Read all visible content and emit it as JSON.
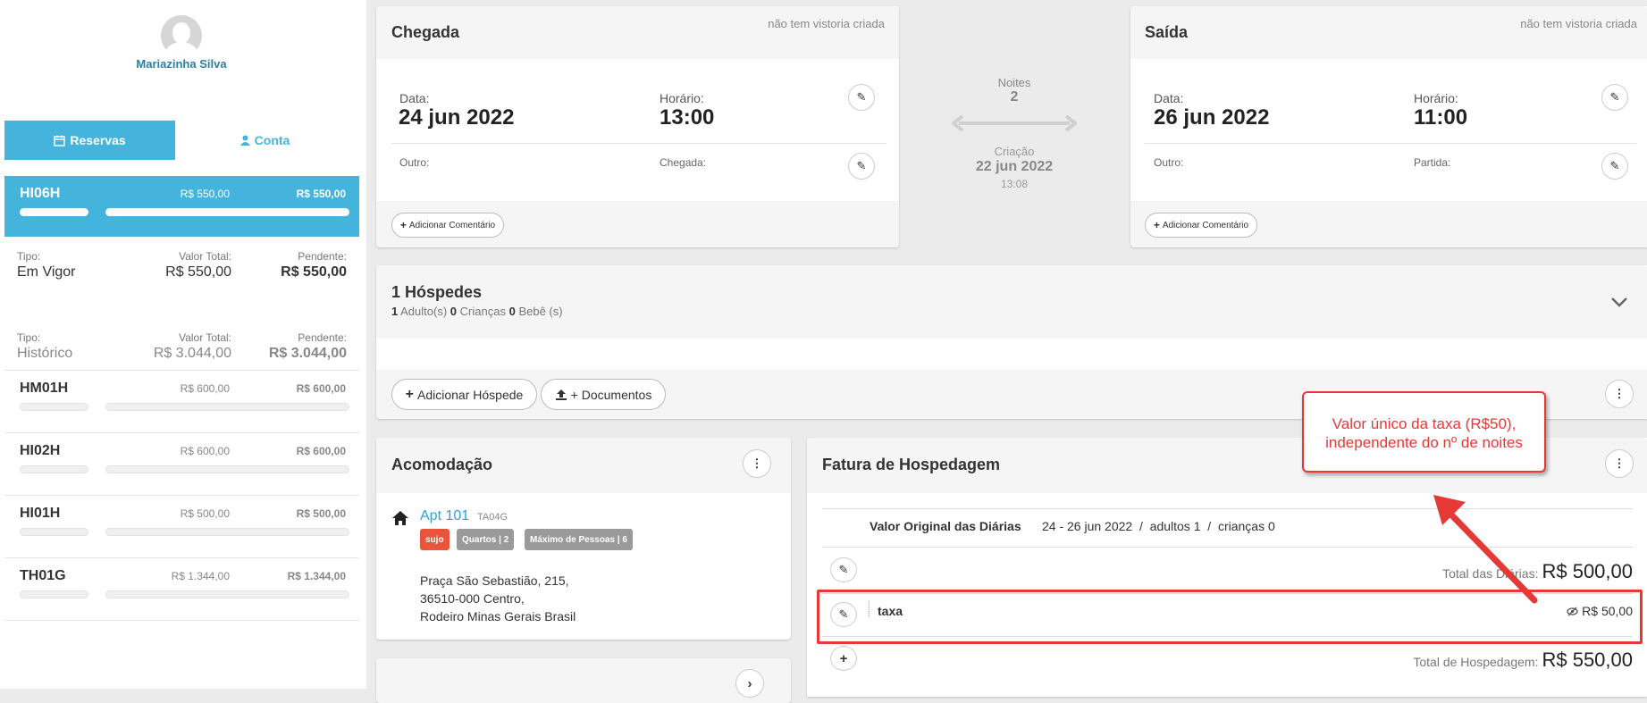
{
  "sidebar": {
    "user_name": "Mariazinha Silva",
    "tabs": [
      {
        "label": "Reservas",
        "icon": "calendar-icon"
      },
      {
        "label": "Conta",
        "icon": "user-icon"
      }
    ],
    "active_reservation": {
      "code": "HI06H",
      "value": "R$ 550,00",
      "pending": "R$ 550,00"
    },
    "summary": [
      {
        "type_label": "Tipo:",
        "type": "Em Vigor",
        "total_label": "Valor Total:",
        "total": "R$ 550,00",
        "pending_label": "Pendente:",
        "pending": "R$ 550,00"
      },
      {
        "type_label": "Tipo:",
        "type": "Histórico",
        "total_label": "Valor Total:",
        "total": "R$ 3.044,00",
        "pending_label": "Pendente:",
        "pending": "R$ 3.044,00"
      }
    ],
    "reservations": [
      {
        "code": "HM01H",
        "value": "R$ 600,00",
        "pending": "R$ 600,00"
      },
      {
        "code": "HI02H",
        "value": "R$ 600,00",
        "pending": "R$ 600,00"
      },
      {
        "code": "HI01H",
        "value": "R$ 500,00",
        "pending": "R$ 500,00"
      },
      {
        "code": "TH01G",
        "value": "R$ 1.344,00",
        "pending": "R$ 1.344,00"
      }
    ]
  },
  "arrival": {
    "title": "Chegada",
    "note": "não tem vistoria criada",
    "date_label": "Data:",
    "date": "24 jun 2022",
    "time_label": "Horário:",
    "time": "13:00",
    "other_label": "Outro:",
    "extra_label": "Chegada:",
    "comment_button": "Adicionar Comentário"
  },
  "middle": {
    "nights_label": "Noites",
    "nights": "2",
    "created_label": "Criação",
    "created_date": "22 jun 2022",
    "created_time": "13:08"
  },
  "departure": {
    "title": "Saída",
    "note": "não tem vistoria criada",
    "date_label": "Data:",
    "date": "26 jun 2022",
    "time_label": "Horário:",
    "time": "11:00",
    "other_label": "Outro:",
    "extra_label": "Partida:",
    "comment_button": "Adicionar Comentário"
  },
  "guests": {
    "title": "1 Hóspedes",
    "adults_count": "1",
    "adults_label": "Adulto(s)",
    "children_count": "0",
    "children_label": "Crianças",
    "babies_count": "0",
    "babies_label": "Bebê (s)",
    "add_guest_button": "Adicionar Hóspede",
    "documents_button": "+ Documentos"
  },
  "accommodation": {
    "title": "Acomodação",
    "room_name": "Apt 101",
    "room_code": "TA04G",
    "badges": [
      {
        "label": "sujo",
        "color": "#e8553a"
      },
      {
        "label": "Quartos | 2",
        "color": "#9a9a9a"
      },
      {
        "label": "Máximo de Pessoas | 6",
        "color": "#9a9a9a"
      }
    ],
    "address_line1": "Praça São Sebastião, 215,",
    "address_line2": "36510-000 Centro,",
    "address_line3": "Rodeiro Minas Gerais Brasil"
  },
  "invoice": {
    "title": "Fatura de Hospedagem",
    "original_label": "Valor Original das Diárias",
    "period": "24 - 26 jun 2022",
    "adults": "adultos 1",
    "children": "crianças 0",
    "total_diarias_label": "Total das Diárias:",
    "total_diarias": "R$ 500,00",
    "fee_name": "taxa",
    "fee_value": "R$ 50,00",
    "total_label": "Total de Hospedagem:",
    "total": "R$ 550,00"
  },
  "annotation": {
    "text_line1": "Valor único da taxa (R$50),",
    "text_line2": "independente do nº de noites",
    "color": "#e53935"
  },
  "colors": {
    "accent": "#45b4dc",
    "link": "#2a7fa6",
    "dirty": "#e8553a"
  }
}
